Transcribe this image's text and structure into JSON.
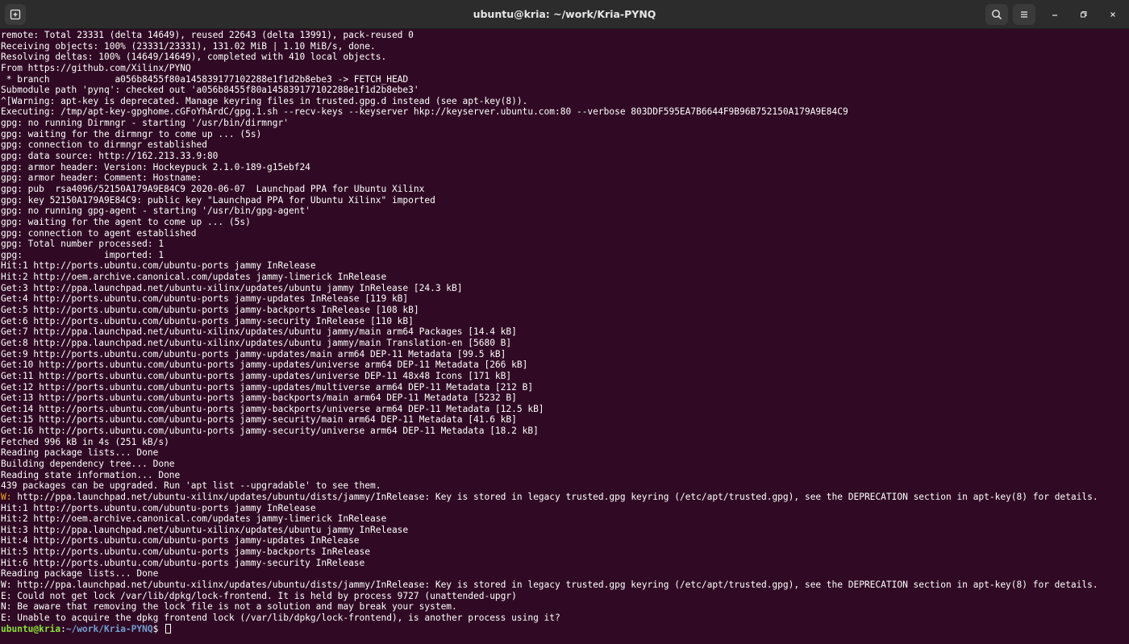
{
  "window": {
    "title": "ubuntu@kria: ~/work/Kria-PYNQ",
    "new_tab_icon": "new-tab-icon",
    "search_icon": "search-icon",
    "menu_icon": "hamburger-menu-icon",
    "minimize_icon": "minimize-icon",
    "maximize_icon": "maximize-icon",
    "close_icon": "close-icon"
  },
  "colors": {
    "background": "#300a24",
    "text": "#ffffff",
    "warning": "#f5a623",
    "prompt_user": "#8ae234",
    "prompt_path": "#729fcf"
  },
  "terminal": {
    "lines": [
      "remote: Total 23331 (delta 14649), reused 22643 (delta 13991), pack-reused 0",
      "Receiving objects: 100% (23331/23331), 131.02 MiB | 1.10 MiB/s, done.",
      "Resolving deltas: 100% (14649/14649), completed with 410 local objects.",
      "From https://github.com/Xilinx/PYNQ",
      " * branch            a056b8455f80a145839177102288e1f1d2b8ebe3 -> FETCH_HEAD",
      "Submodule path 'pynq': checked out 'a056b8455f80a145839177102288e1f1d2b8ebe3'",
      "^[Warning: apt-key is deprecated. Manage keyring files in trusted.gpg.d instead (see apt-key(8)).",
      "Executing: /tmp/apt-key-gpghome.cGFoYhArdC/gpg.1.sh --recv-keys --keyserver hkp://keyserver.ubuntu.com:80 --verbose 803DDF595EA7B6644F9B96B752150A179A9E84C9",
      "gpg: no running Dirmngr - starting '/usr/bin/dirmngr'",
      "gpg: waiting for the dirmngr to come up ... (5s)",
      "gpg: connection to dirmngr established",
      "gpg: data source: http://162.213.33.9:80",
      "gpg: armor header: Version: Hockeypuck 2.1.0-189-g15ebf24",
      "gpg: armor header: Comment: Hostname:",
      "gpg: pub  rsa4096/52150A179A9E84C9 2020-06-07  Launchpad PPA for Ubuntu Xilinx",
      "gpg: key 52150A179A9E84C9: public key \"Launchpad PPA for Ubuntu Xilinx\" imported",
      "gpg: no running gpg-agent - starting '/usr/bin/gpg-agent'",
      "gpg: waiting for the agent to come up ... (5s)",
      "gpg: connection to agent established",
      "gpg: Total number processed: 1",
      "gpg:               imported: 1",
      "Hit:1 http://ports.ubuntu.com/ubuntu-ports jammy InRelease",
      "Hit:2 http://oem.archive.canonical.com/updates jammy-limerick InRelease",
      "Get:3 http://ppa.launchpad.net/ubuntu-xilinx/updates/ubuntu jammy InRelease [24.3 kB]",
      "Get:4 http://ports.ubuntu.com/ubuntu-ports jammy-updates InRelease [119 kB]",
      "Get:5 http://ports.ubuntu.com/ubuntu-ports jammy-backports InRelease [108 kB]",
      "Get:6 http://ports.ubuntu.com/ubuntu-ports jammy-security InRelease [110 kB]",
      "Get:7 http://ppa.launchpad.net/ubuntu-xilinx/updates/ubuntu jammy/main arm64 Packages [14.4 kB]",
      "Get:8 http://ppa.launchpad.net/ubuntu-xilinx/updates/ubuntu jammy/main Translation-en [5680 B]",
      "Get:9 http://ports.ubuntu.com/ubuntu-ports jammy-updates/main arm64 DEP-11 Metadata [99.5 kB]",
      "Get:10 http://ports.ubuntu.com/ubuntu-ports jammy-updates/universe arm64 DEP-11 Metadata [266 kB]",
      "Get:11 http://ports.ubuntu.com/ubuntu-ports jammy-updates/universe DEP-11 48x48 Icons [171 kB]",
      "Get:12 http://ports.ubuntu.com/ubuntu-ports jammy-updates/multiverse arm64 DEP-11 Metadata [212 B]",
      "Get:13 http://ports.ubuntu.com/ubuntu-ports jammy-backports/main arm64 DEP-11 Metadata [5232 B]",
      "Get:14 http://ports.ubuntu.com/ubuntu-ports jammy-backports/universe arm64 DEP-11 Metadata [12.5 kB]",
      "Get:15 http://ports.ubuntu.com/ubuntu-ports jammy-security/main arm64 DEP-11 Metadata [41.6 kB]",
      "Get:16 http://ports.ubuntu.com/ubuntu-ports jammy-security/universe arm64 DEP-11 Metadata [18.2 kB]",
      "Fetched 996 kB in 4s (251 kB/s)",
      "Reading package lists... Done",
      "Building dependency tree... Done",
      "Reading state information... Done",
      "439 packages can be upgraded. Run 'apt list --upgradable' to see them."
    ],
    "warning_line": {
      "prefix": "W:",
      "text": " http://ppa.launchpad.net/ubuntu-xilinx/updates/ubuntu/dists/jammy/InRelease: Key is stored in legacy trusted.gpg keyring (/etc/apt/trusted.gpg), see the DEPRECATION section in apt-key(8) for details."
    },
    "lines_after": [
      "Hit:1 http://ports.ubuntu.com/ubuntu-ports jammy InRelease",
      "Hit:2 http://oem.archive.canonical.com/updates jammy-limerick InRelease",
      "Hit:3 http://ppa.launchpad.net/ubuntu-xilinx/updates/ubuntu jammy InRelease",
      "Hit:4 http://ports.ubuntu.com/ubuntu-ports jammy-updates InRelease",
      "Hit:5 http://ports.ubuntu.com/ubuntu-ports jammy-backports InRelease",
      "Hit:6 http://ports.ubuntu.com/ubuntu-ports jammy-security InRelease",
      "Reading package lists... Done",
      "W: http://ppa.launchpad.net/ubuntu-xilinx/updates/ubuntu/dists/jammy/InRelease: Key is stored in legacy trusted.gpg keyring (/etc/apt/trusted.gpg), see the DEPRECATION section in apt-key(8) for details.",
      "E: Could not get lock /var/lib/dpkg/lock-frontend. It is held by process 9727 (unattended-upgr)",
      "N: Be aware that removing the lock file is not a solution and may break your system.",
      "E: Unable to acquire the dpkg frontend lock (/var/lib/dpkg/lock-frontend), is another process using it?"
    ],
    "prompt": {
      "user_host": "ubuntu@kria",
      "separator": ":",
      "path": "~/work/Kria-PYNQ",
      "symbol": "$ "
    }
  }
}
